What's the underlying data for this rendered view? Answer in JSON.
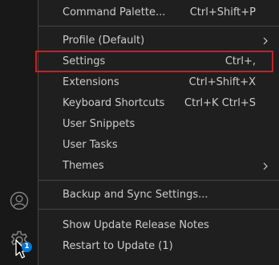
{
  "activity_bar": {
    "accounts_icon": "account-icon",
    "manage_icon": "gear-icon",
    "manage_badge": "1"
  },
  "menu": {
    "items": [
      {
        "label": "Command Palette...",
        "shortcut": "Ctrl+Shift+P"
      },
      {
        "label": "Profile (Default)",
        "submenu": true
      },
      {
        "label": "Settings",
        "shortcut": "Ctrl+,"
      },
      {
        "label": "Extensions",
        "shortcut": "Ctrl+Shift+X"
      },
      {
        "label": "Keyboard Shortcuts",
        "shortcut": "Ctrl+K Ctrl+S"
      },
      {
        "label": "User Snippets"
      },
      {
        "label": "User Tasks"
      },
      {
        "label": "Themes",
        "submenu": true
      },
      {
        "label": "Backup and Sync Settings..."
      },
      {
        "label": "Show Update Release Notes"
      },
      {
        "label": "Restart to Update (1)"
      }
    ]
  },
  "colors": {
    "menu_background": "#1f1f1f",
    "menu_text": "#cccccc",
    "separator": "#454545",
    "highlight_border": "#e3151a",
    "badge": "#0078d4"
  }
}
